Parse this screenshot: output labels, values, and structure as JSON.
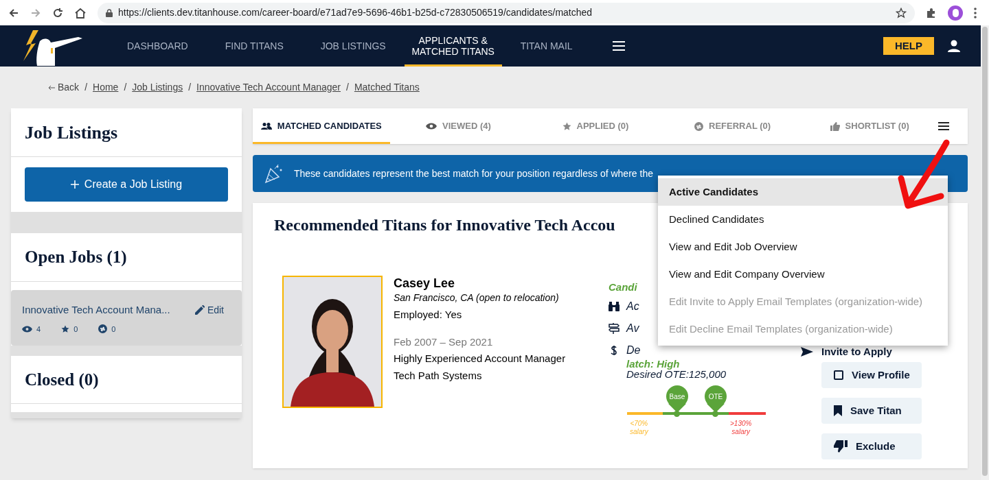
{
  "browser": {
    "url": "https://clients.dev.titanhouse.com/career-board/e71ad7e9-5696-46b1-b25d-c72830506519/candidates/matched"
  },
  "nav": {
    "items": [
      {
        "label": "DASHBOARD",
        "selected": false
      },
      {
        "label": "FIND TITANS",
        "selected": false
      },
      {
        "label": "JOB LISTINGS",
        "selected": false
      },
      {
        "label": "APPLICANTS & MATCHED TITANS",
        "selected": true
      },
      {
        "label": "TITAN MAIL",
        "selected": false
      }
    ],
    "help_button": "HELP"
  },
  "breadcrumb": {
    "back": "Back",
    "separator": "/",
    "items": [
      "Home",
      "Job Listings",
      "Innovative Tech Account Manager",
      "Matched Titans"
    ]
  },
  "sidebar": {
    "title": "Job Listings",
    "create_button": "Create a Job Listing",
    "open_title": "Open Jobs (1)",
    "jobs": [
      {
        "title": "Innovative Tech Account Mana...",
        "edit": "Edit",
        "views": "4",
        "stars": "0",
        "referrals": "0",
        "selected": true
      }
    ],
    "closed_title": "Closed (0)"
  },
  "tabs": [
    {
      "label": "MATCHED CANDIDATES",
      "selected": true
    },
    {
      "label": "VIEWED (4)",
      "selected": false
    },
    {
      "label": "APPLIED (0)",
      "selected": false
    },
    {
      "label": "REFERRAL (0)",
      "selected": false
    },
    {
      "label": "SHORTLIST (0)",
      "selected": false
    }
  ],
  "banner": "These candidates represent the best match for your position regardless of where the",
  "card_title": "Recommended Titans for Innovative Tech Accou",
  "candidate": {
    "name": "Casey Lee",
    "location": "San Francisco, CA (open to relocation)",
    "employed": "Employed: Yes",
    "dates": "Feb 2007 – Sep 2021",
    "headline": "Highly Experienced Account Manager",
    "company": "Tech Path Systems",
    "match_heading": "Candi",
    "details": [
      "Ac",
      "Av",
      "De"
    ],
    "match": "latch: High",
    "desired": "Desired OTE:125,000",
    "salary": {
      "base": "Base",
      "ote": "OTE",
      "low": "<70%",
      "low_unit": "salary",
      "high": ">130%",
      "high_unit": "salary"
    },
    "actions": [
      {
        "label": "Invite to Apply",
        "kind": "link"
      },
      {
        "label": "View Profile",
        "kind": "button"
      },
      {
        "label": "Save Titan",
        "kind": "button"
      },
      {
        "label": "Exclude",
        "kind": "button"
      }
    ]
  },
  "menu": [
    {
      "label": "Active Candidates",
      "selected": true,
      "disabled": false
    },
    {
      "label": "Declined Candidates",
      "selected": false,
      "disabled": false
    },
    {
      "label": "View and Edit Job Overview",
      "selected": false,
      "disabled": false
    },
    {
      "label": "View and Edit Company Overview",
      "selected": false,
      "disabled": false
    },
    {
      "label": "Edit Invite to Apply Email Templates (organization-wide)",
      "selected": false,
      "disabled": true
    },
    {
      "label": "Edit Decline Email Templates (organization-wide)",
      "selected": false,
      "disabled": true
    }
  ]
}
